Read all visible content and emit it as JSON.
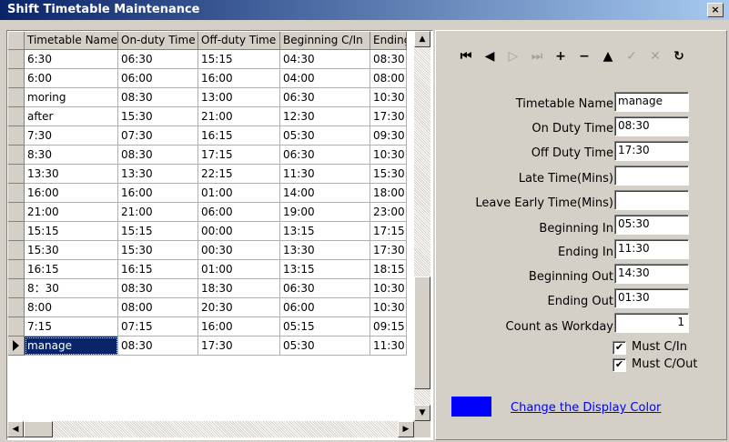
{
  "window": {
    "title": "Shift Timetable Maintenance",
    "close_glyph": "×"
  },
  "grid": {
    "columns": [
      "Timetable Name",
      "On-duty Time",
      "Off-duty Time",
      "Beginning C/In",
      "Ending"
    ],
    "rows": [
      [
        "6:30",
        "06:30",
        "15:15",
        "04:30",
        "08:30"
      ],
      [
        "6:00",
        "06:00",
        "16:00",
        "04:00",
        "08:00"
      ],
      [
        "moring",
        "08:30",
        "13:00",
        "06:30",
        "10:30"
      ],
      [
        "after",
        "15:30",
        "21:00",
        "12:30",
        "17:30"
      ],
      [
        "7:30",
        "07:30",
        "16:15",
        "05:30",
        "09:30"
      ],
      [
        "8:30",
        "08:30",
        "17:15",
        "06:30",
        "10:30"
      ],
      [
        "13:30",
        "13:30",
        "22:15",
        "11:30",
        "15:30"
      ],
      [
        "16:00",
        "16:00",
        "01:00",
        "14:00",
        "18:00"
      ],
      [
        "21:00",
        "21:00",
        "06:00",
        "19:00",
        "23:00"
      ],
      [
        "15:15",
        "15:15",
        "00:00",
        "13:15",
        "17:15"
      ],
      [
        "15:30",
        "15:30",
        "00:30",
        "13:30",
        "17:30"
      ],
      [
        "16:15",
        "16:15",
        "01:00",
        "13:15",
        "18:15"
      ],
      [
        "8：30",
        "08:30",
        "18:30",
        "06:30",
        "10:30"
      ],
      [
        "8:00",
        "08:00",
        "20:30",
        "06:00",
        "10:30"
      ],
      [
        "7:15",
        "07:15",
        "16:00",
        "05:15",
        "09:15"
      ],
      [
        "manage",
        "08:30",
        "17:30",
        "05:30",
        "11:30"
      ]
    ],
    "selected_row": 15
  },
  "navigator": {
    "buttons": [
      {
        "name": "first-record-icon",
        "glyph": "⏮",
        "enabled": true
      },
      {
        "name": "prior-record-icon",
        "glyph": "◀",
        "enabled": true
      },
      {
        "name": "next-record-icon",
        "glyph": "▷",
        "enabled": false
      },
      {
        "name": "last-record-icon",
        "glyph": "⏭",
        "enabled": false
      },
      {
        "name": "insert-record-icon",
        "glyph": "+",
        "enabled": true
      },
      {
        "name": "delete-record-icon",
        "glyph": "−",
        "enabled": true
      },
      {
        "name": "edit-record-icon",
        "glyph": "▲",
        "enabled": true
      },
      {
        "name": "post-edit-icon",
        "glyph": "✓",
        "enabled": false
      },
      {
        "name": "cancel-edit-icon",
        "glyph": "✕",
        "enabled": false
      },
      {
        "name": "refresh-icon",
        "glyph": "↻",
        "enabled": true
      }
    ]
  },
  "form": {
    "timetable_name_label": "Timetable Name",
    "timetable_name": "manage",
    "on_duty_label": "On Duty Time",
    "on_duty": "08:30",
    "off_duty_label": "Off Duty Time",
    "off_duty": "17:30",
    "late_time_label": "Late Time(Mins)",
    "late_time": "",
    "leave_early_label": "Leave Early Time(Mins)",
    "leave_early": "",
    "beginning_in_label": "Beginning In",
    "beginning_in": "05:30",
    "ending_in_label": "Ending In",
    "ending_in": "11:30",
    "beginning_out_label": "Beginning Out",
    "beginning_out": "14:30",
    "ending_out_label": "Ending Out",
    "ending_out": "01:30",
    "count_workday_label": "Count as Workday",
    "count_workday": "1",
    "must_cin_label": "Must C/In",
    "must_cin_checked": true,
    "must_cout_label": "Must C/Out",
    "must_cout_checked": true,
    "check_glyph": "✔",
    "display_color": "#0000ff",
    "change_color_label": "Change the Display Color"
  },
  "scroll": {
    "up": "▲",
    "down": "▼",
    "left": "◀",
    "right": "▶"
  }
}
